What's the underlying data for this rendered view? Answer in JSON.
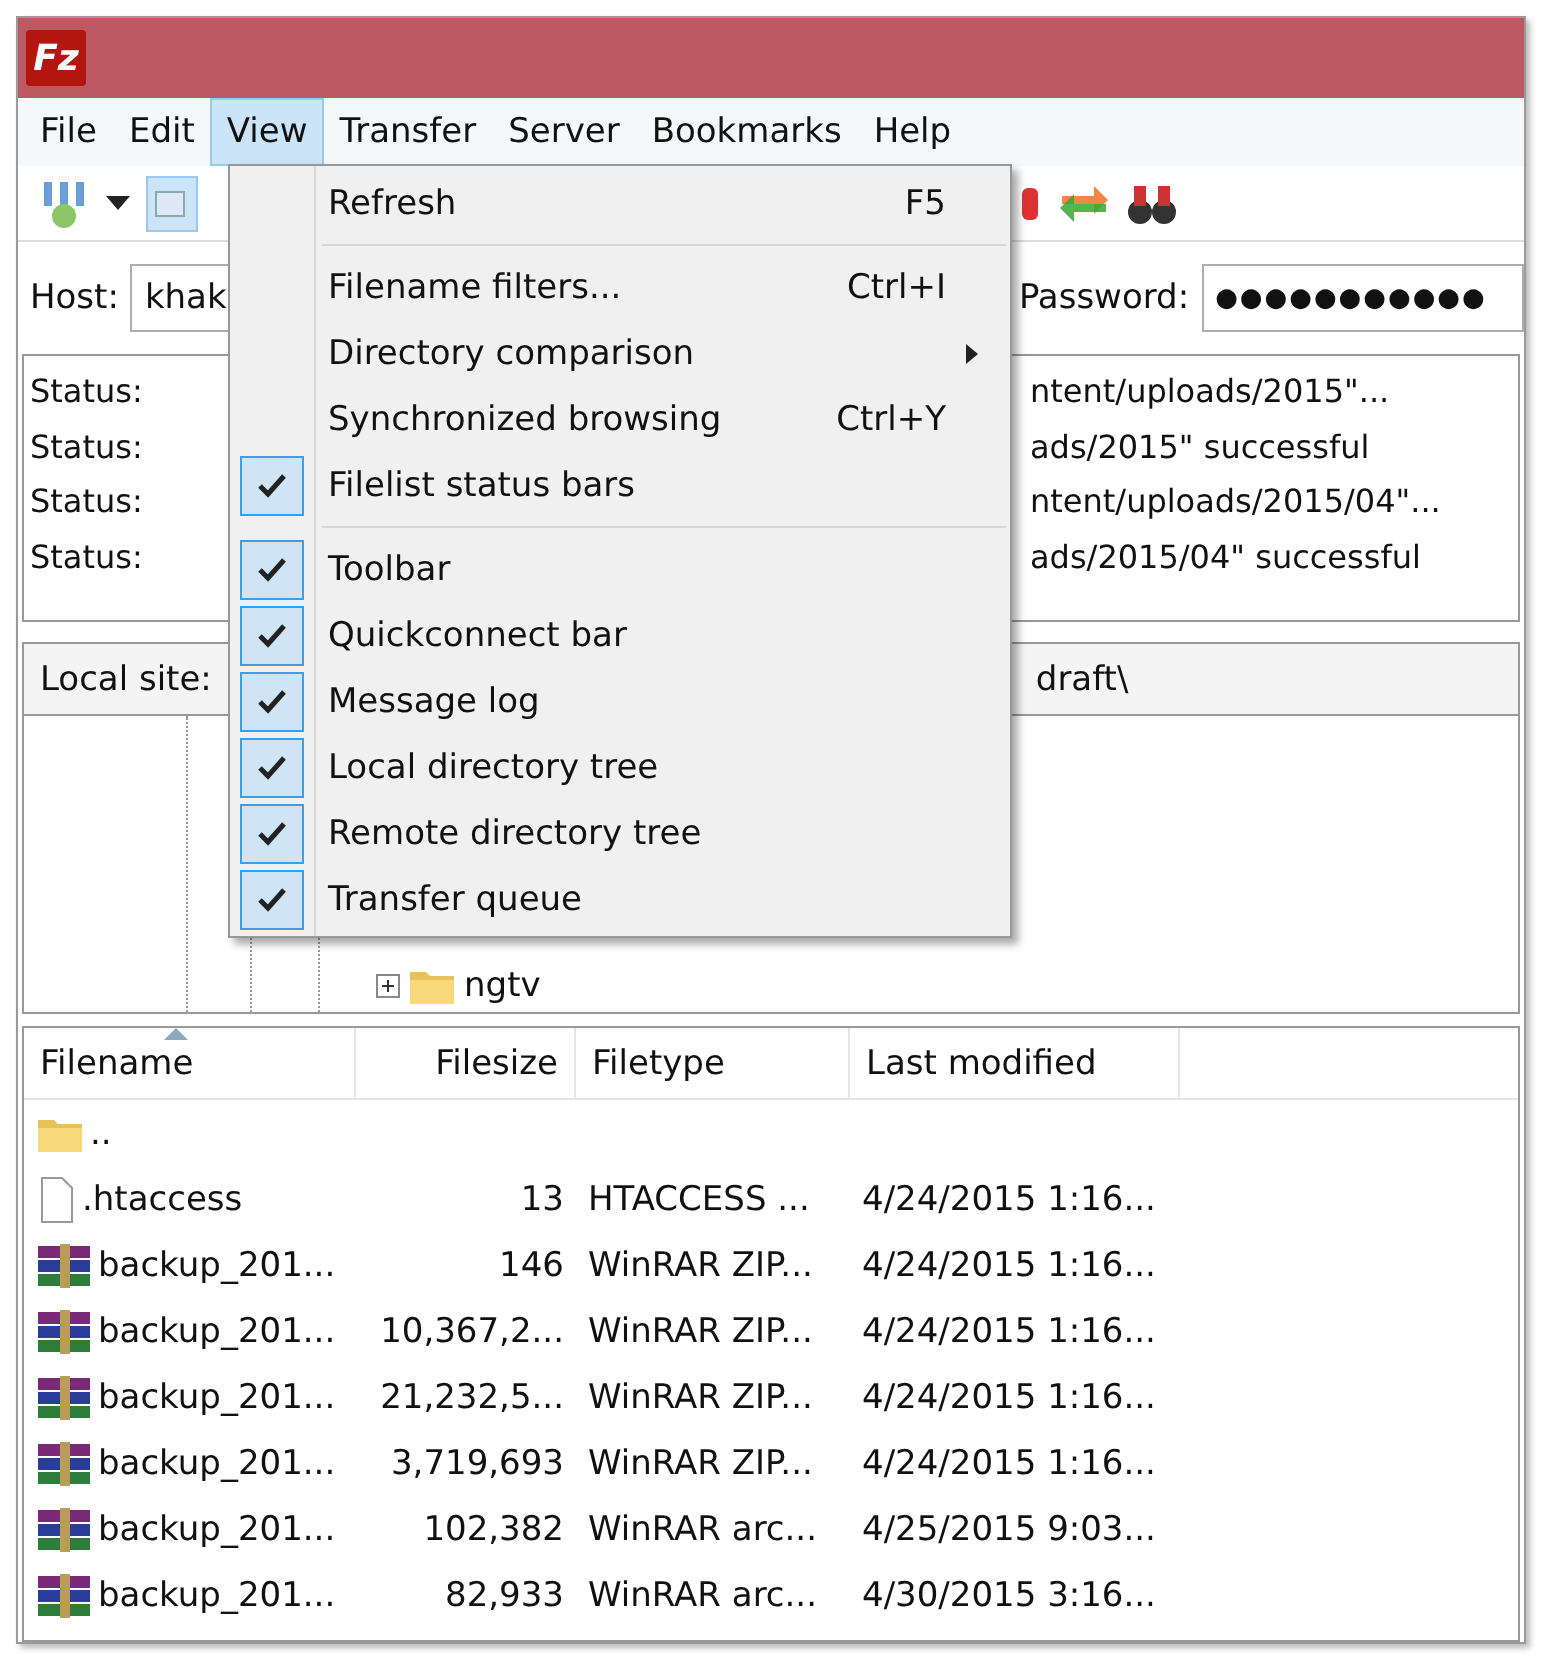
{
  "window": {
    "logo": "Fz"
  },
  "menu_bar": [
    {
      "label": "File",
      "selected": false
    },
    {
      "label": "Edit",
      "selected": false
    },
    {
      "label": "View",
      "selected": true
    },
    {
      "label": "Transfer",
      "selected": false
    },
    {
      "label": "Server",
      "selected": false
    },
    {
      "label": "Bookmarks",
      "selected": false
    },
    {
      "label": "Help",
      "selected": false
    }
  ],
  "view_menu": [
    {
      "kind": "command",
      "label": "Refresh",
      "shortcut": "F5",
      "checked": false
    },
    {
      "kind": "separator"
    },
    {
      "kind": "command",
      "label": "Filename filters...",
      "shortcut": "Ctrl+I",
      "checked": false
    },
    {
      "kind": "submenu",
      "label": "Directory comparison",
      "checked": false
    },
    {
      "kind": "command",
      "label": "Synchronized browsing",
      "shortcut": "Ctrl+Y",
      "checked": false
    },
    {
      "kind": "command",
      "label": "Filelist status bars",
      "checked": true
    },
    {
      "kind": "separator"
    },
    {
      "kind": "command",
      "label": "Toolbar",
      "checked": true
    },
    {
      "kind": "command",
      "label": "Quickconnect bar",
      "checked": true
    },
    {
      "kind": "command",
      "label": "Message log",
      "checked": true
    },
    {
      "kind": "command",
      "label": "Local directory tree",
      "checked": true
    },
    {
      "kind": "command",
      "label": "Remote directory tree",
      "checked": true
    },
    {
      "kind": "command",
      "label": "Transfer queue",
      "checked": true
    }
  ],
  "quickconnect": {
    "host_label": "Host:",
    "host_value": "khak",
    "password_label": "Password:",
    "password_value": "●●●●●●●●●●●"
  },
  "message_log": [
    {
      "label": "Status:",
      "message": "ntent/uploads/2015\"..."
    },
    {
      "label": "Status:",
      "message": "ads/2015\" successful"
    },
    {
      "label": "Status:",
      "message": "ntent/uploads/2015/04\"..."
    },
    {
      "label": "Status:",
      "message": "ads/2015/04\" successful"
    }
  ],
  "local_site": {
    "label": "Local site:",
    "path": "draft\\"
  },
  "local_tree": [
    {
      "name": "ngtv",
      "expanded": false
    }
  ],
  "file_list": {
    "columns": [
      {
        "label": "Filename",
        "sorted": true
      },
      {
        "label": "Filesize",
        "sorted": false
      },
      {
        "label": "Filetype",
        "sorted": false
      },
      {
        "label": "Last modified",
        "sorted": false
      }
    ],
    "rows": [
      {
        "kind": "folder",
        "name": ".."
      },
      {
        "kind": "file",
        "name": ".htaccess",
        "size": "13",
        "type": "HTACCESS ...",
        "modified": "4/24/2015 1:16..."
      },
      {
        "kind": "archive",
        "name": "backup_201...",
        "size": "146",
        "type": "WinRAR ZIP...",
        "modified": "4/24/2015 1:16..."
      },
      {
        "kind": "archive",
        "name": "backup_201...",
        "size": "10,367,2...",
        "type": "WinRAR ZIP...",
        "modified": "4/24/2015 1:16..."
      },
      {
        "kind": "archive",
        "name": "backup_201...",
        "size": "21,232,5...",
        "type": "WinRAR ZIP...",
        "modified": "4/24/2015 1:16..."
      },
      {
        "kind": "archive",
        "name": "backup_201...",
        "size": "3,719,693",
        "type": "WinRAR ZIP...",
        "modified": "4/24/2015 1:16..."
      },
      {
        "kind": "archive",
        "name": "backup_201...",
        "size": "102,382",
        "type": "WinRAR arc...",
        "modified": "4/25/2015 9:03..."
      },
      {
        "kind": "archive",
        "name": "backup_201...",
        "size": "82,933",
        "type": "WinRAR arc...",
        "modified": "4/30/2015 3:16..."
      }
    ]
  }
}
